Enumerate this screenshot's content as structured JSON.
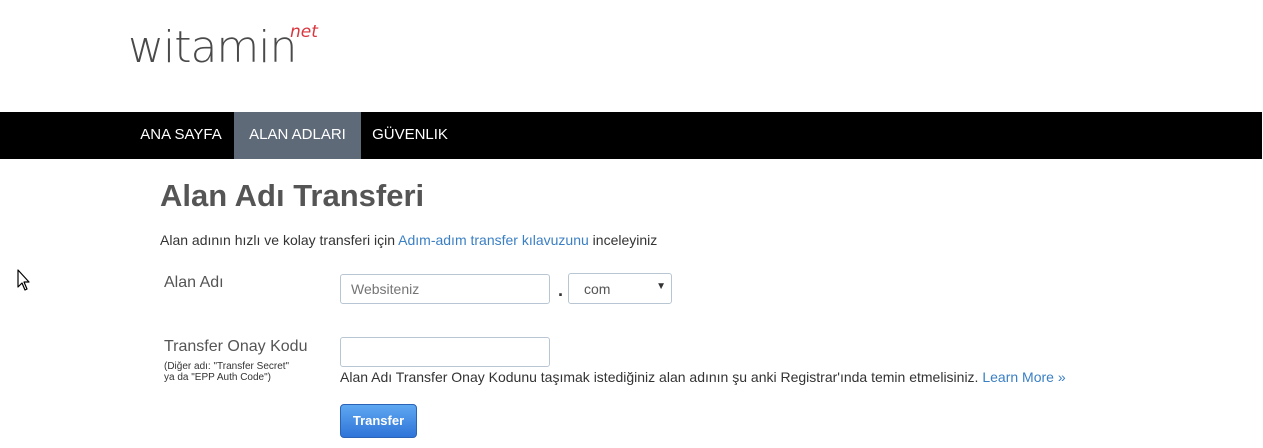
{
  "logo": {
    "name": "witamin",
    "tld": "net"
  },
  "nav": {
    "items": [
      {
        "label": "ANA SAYFA"
      },
      {
        "label": "ALAN ADLARI"
      },
      {
        "label": "GÜVENLIK"
      }
    ],
    "active_index": 1
  },
  "page": {
    "title": "Alan Adı Transferi",
    "intro_before": "Alan adının hızlı ve kolay transferi için",
    "intro_link": "Adım-adım transfer kılavuzunu",
    "intro_after": "inceleyiniz"
  },
  "form": {
    "domain_label": "Alan Adı",
    "domain_placeholder": "Websiteniz",
    "domain_separator": ".",
    "tld_selected": "com",
    "auth_label": "Transfer Onay Kodu",
    "auth_hint_line1": "(Diğer adı: \"Transfer Secret\"",
    "auth_hint_line2": "ya da \"EPP Auth Code\")",
    "auth_value": "",
    "helper_text": "Alan Adı Transfer Onay Kodunu taşımak istediğiniz alan adının şu anki Registrar'ında temin etmelisiniz.",
    "learn_more": "Learn More »",
    "submit_label": "Transfer"
  },
  "colors": {
    "nav_background": "#000000",
    "nav_active": "#5e6a78",
    "link": "#3a7fc4",
    "button": "#2f74d8",
    "logo_tld": "#d9363e"
  },
  "icons": {
    "cursor": "mouse-pointer-icon",
    "select_caret": "caret-down-icon"
  }
}
